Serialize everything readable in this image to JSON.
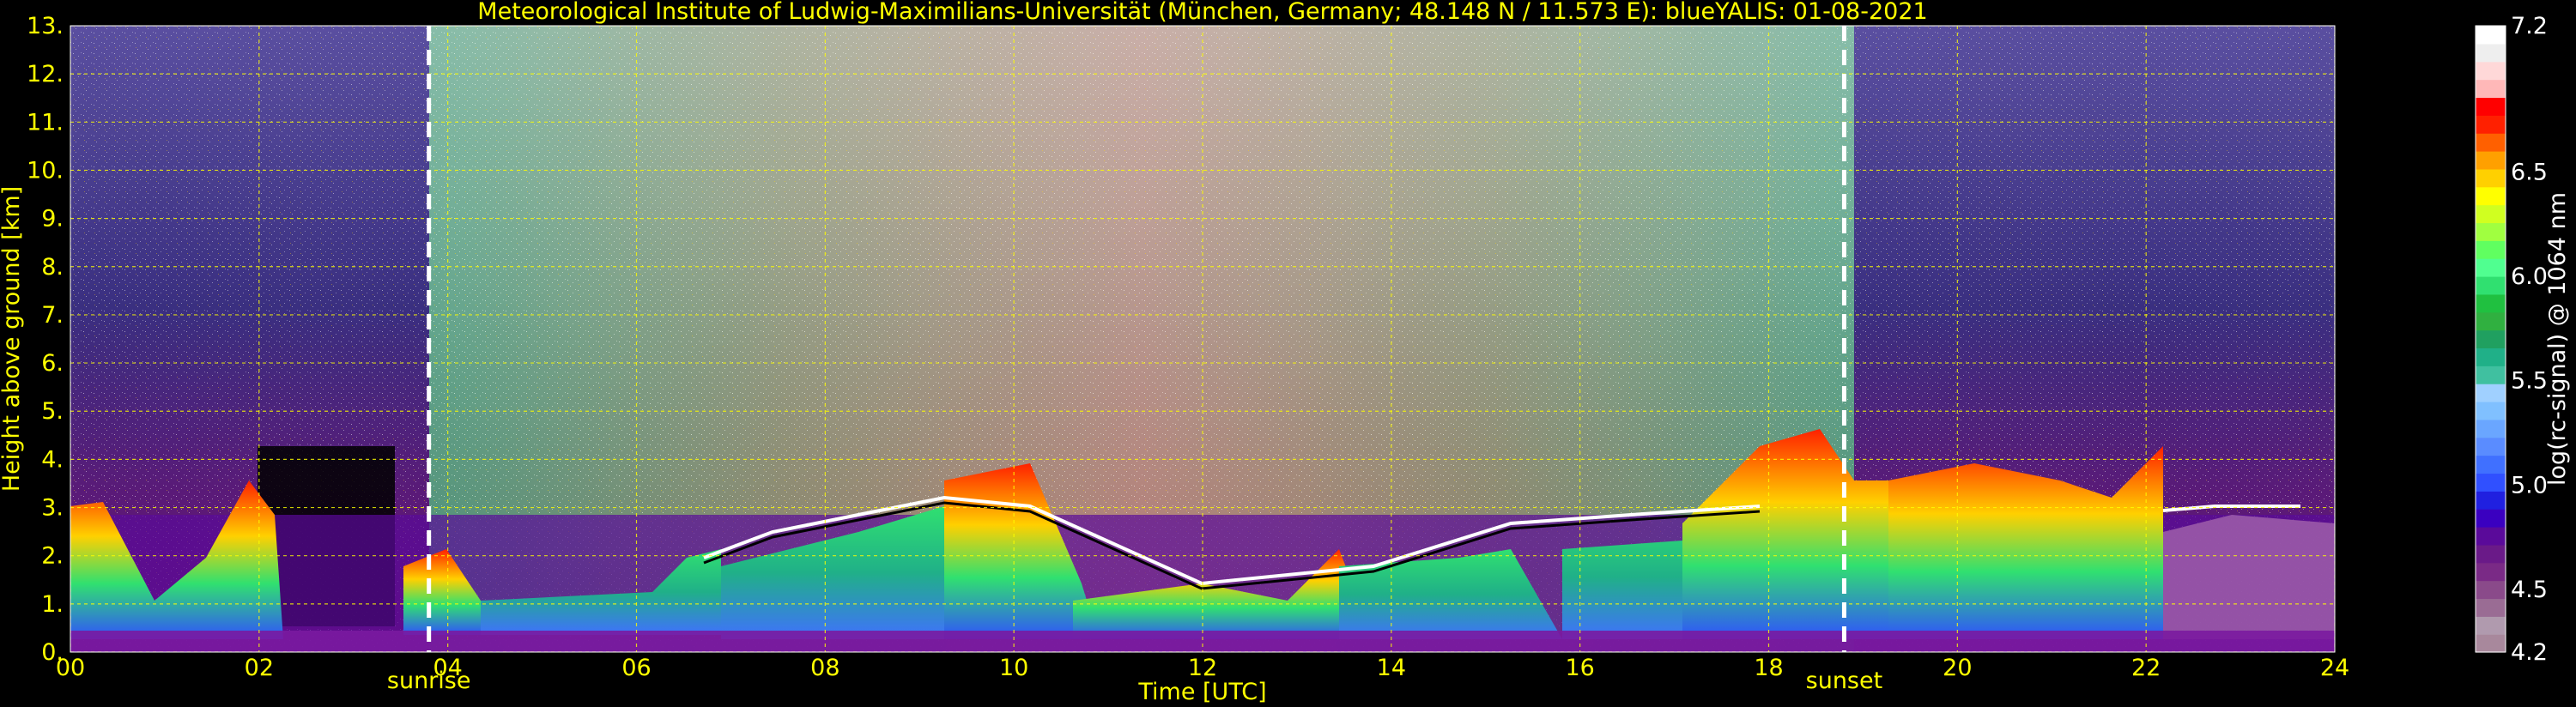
{
  "chart_data": {
    "type": "heatmap",
    "title": "Meteorological Institute of Ludwig-Maximilians-Universität (München, Germany; 48.148 N / 11.573 E):     blueYALIS: 01-08-2021",
    "xlabel": "Time [UTC]",
    "ylabel": "Height above ground [km]",
    "colorbar_label": "log(rc-signal) @ 1064 nm",
    "xlim": [
      0,
      24
    ],
    "ylim": [
      0,
      13
    ],
    "x_ticks": [
      "00",
      "02",
      "04",
      "06",
      "08",
      "10",
      "12",
      "14",
      "16",
      "18",
      "20",
      "22",
      "24"
    ],
    "y_ticks": [
      "0.",
      "1.",
      "2.",
      "3.",
      "4.",
      "5.",
      "6.",
      "7.",
      "8.",
      "9.",
      "10.",
      "11.",
      "12.",
      "13."
    ],
    "colorbar_range": [
      4.2,
      7.2
    ],
    "colorbar_ticks": [
      "4.2",
      "4.5",
      "5.0",
      "5.5",
      "6.0",
      "6.5",
      "7.2"
    ],
    "colorbar_tick_values": [
      4.2,
      4.5,
      5.0,
      5.5,
      6.0,
      6.5,
      7.2
    ],
    "colorbar_colors": [
      "#a8889c",
      "#b09aae",
      "#9a6c94",
      "#8a4a8a",
      "#7a2a86",
      "#6a1a88",
      "#5a0a9a",
      "#3a00c0",
      "#2020e0",
      "#3050ff",
      "#4070ff",
      "#5a8cff",
      "#6aa6ff",
      "#80c0ff",
      "#a0d0ff",
      "#40c0a0",
      "#20b088",
      "#20a060",
      "#30b040",
      "#20c040",
      "#30e070",
      "#50ff90",
      "#60ff60",
      "#a0ff40",
      "#d0ff20",
      "#ffff00",
      "#ffd000",
      "#ffa000",
      "#ff6000",
      "#ff2000",
      "#ff0000",
      "#ffb8b8",
      "#ffd8d8",
      "#eeeeee",
      "#ffffff"
    ],
    "events": [
      {
        "label": "sunrise",
        "time": 3.8
      },
      {
        "label": "sunset",
        "time": 18.8
      }
    ],
    "grid": true,
    "colors": {
      "axis_text": "#ffff00",
      "grid": "#ffff00",
      "event_line": "#ffffff",
      "background": "#000000"
    }
  }
}
